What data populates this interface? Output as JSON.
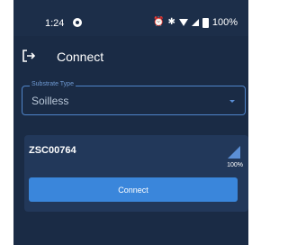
{
  "status_bar": {
    "time": "1:24",
    "battery_text": "100%",
    "icons": [
      "app-notification-icon",
      "alarm-icon",
      "bluetooth-icon",
      "wifi-icon",
      "cell-signal-icon",
      "battery-icon"
    ]
  },
  "app_bar": {
    "title": "Connect",
    "nav_icon": "logout-icon"
  },
  "substrate_field": {
    "label": "Substrate Type",
    "value": "Soilless"
  },
  "device": {
    "name": "ZSC00764",
    "signal_text": "100%",
    "signal_level": 1.0,
    "connect_label": "Connect"
  },
  "colors": {
    "background": "#1a2b45",
    "card": "#22385a",
    "accent": "#3a86db",
    "outline": "#4f84c9"
  }
}
